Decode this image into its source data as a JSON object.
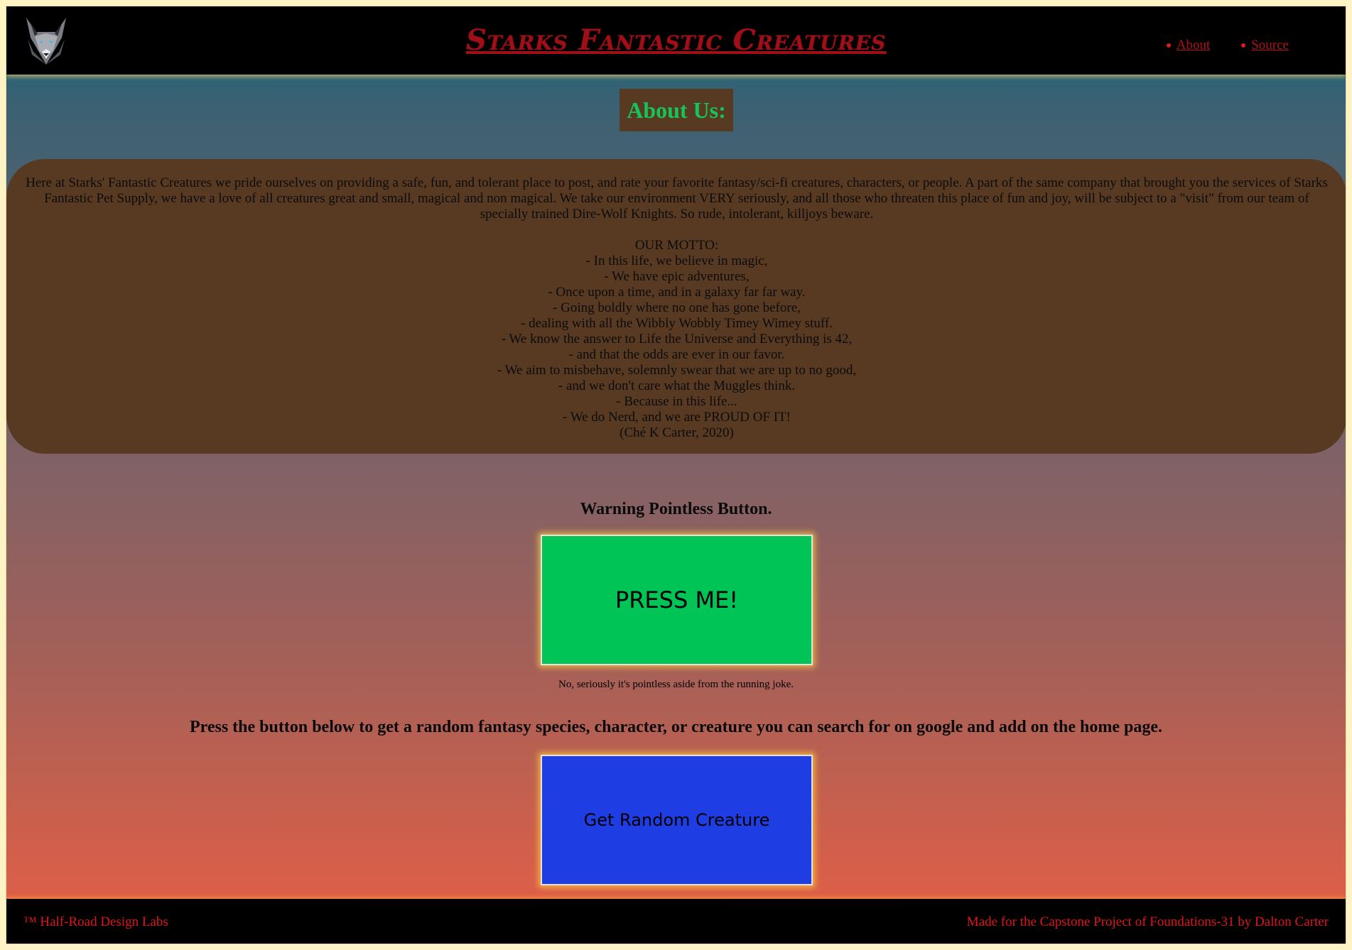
{
  "header": {
    "title": "Starks Fantastic Creatures",
    "logo_icon": "wolf-logo-icon",
    "nav": [
      {
        "label": "About"
      },
      {
        "label": "Source"
      }
    ]
  },
  "about": {
    "heading": "About Us:",
    "paragraph": "Here at Starks' Fantastic Creatures we pride ourselves on providing a safe, fun, and tolerant place to post, and rate your favorite fantasy/sci-fi creatures, characters, or people. A part of the same company that brought you the services of Starks Fantastic Pet Supply, we have a love of all creatures great and small, magical and non magical. We take our environment VERY seriously, and all those who threaten this place of fun and joy, will be subject to a \"visit\" from our team of specially trained Dire-Wolf Knights. So rude, intolerant, killjoys beware.",
    "motto_title": "OUR MOTTO:",
    "motto_lines": [
      "- In this life, we believe in magic,",
      "- We have epic adventures,",
      "- Once upon a time, and in a galaxy far far way.",
      "- Going boldly where no one has gone before,",
      "- dealing with all the Wibbly Wobbly Timey Wimey stuff.",
      "- We know the answer to Life the Universe and Everything is 42,",
      "- and that the odds are ever in our favor.",
      "- We aim to misbehave, solemnly swear that we are up to no good,",
      "- and we don't care what the Muggles think.",
      "- Because in this life...",
      "- We do Nerd, and we are PROUD OF IT!",
      "(Ché K Carter, 2020)"
    ]
  },
  "pointless": {
    "title": "Warning Pointless Button.",
    "button_label": "PRESS ME!",
    "note": "No, seriously it's pointless aside from the running joke."
  },
  "random": {
    "title": "Press the button below to get a random fantasy species, character, or creature you can search for on google and add on the home page.",
    "button_label": "Get Random Creature"
  },
  "footer": {
    "left": "™ Half-Road Design Labs",
    "right": "Made for the Capstone Project of Foundations-31 by Dalton Carter"
  },
  "colors": {
    "title_red": "#9e0f17",
    "about_heading_green": "#16c45a",
    "panel_brown": "#583a22",
    "press_button_green": "#00c456",
    "random_button_blue": "#1e3de3",
    "footer_text_red": "#e0141c"
  }
}
